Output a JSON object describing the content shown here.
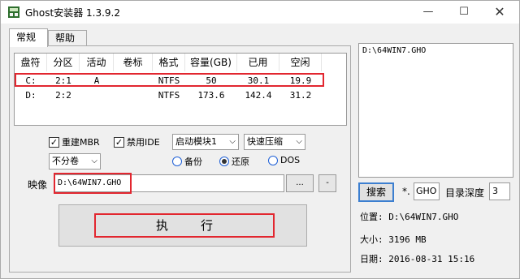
{
  "window": {
    "title": "Ghost安装器 1.3.9.2",
    "minimize": "—",
    "maximize": "☐",
    "close": "✕"
  },
  "tabs": [
    {
      "label": "常规"
    },
    {
      "label": "帮助"
    }
  ],
  "partition_table": {
    "headers": [
      "盘符",
      "分区",
      "活动",
      "卷标",
      "格式",
      "容量(GB)",
      "已用",
      "空闲"
    ],
    "rows": [
      [
        "C:",
        "2:1",
        "A",
        "",
        "NTFS",
        "50",
        "30.1",
        "19.9"
      ],
      [
        "D:",
        "2:2",
        "",
        "",
        "NTFS",
        "173.6",
        "142.4",
        "31.2"
      ]
    ]
  },
  "options": {
    "rebuild_mbr": {
      "label": "重建MBR",
      "checked": true
    },
    "disable_ide": {
      "label": "禁用IDE",
      "checked": true
    },
    "boot_module": "启动模块1",
    "compress": "快速压缩",
    "split": "不分卷",
    "mode": {
      "backup": "备份",
      "restore": "还原",
      "dos": "DOS",
      "selected": "restore"
    }
  },
  "image": {
    "label": "映像",
    "path": "D:\\64WIN7.GHO",
    "browse_label": "...",
    "minus_label": "-"
  },
  "execute_label": "执行",
  "right_panel": {
    "file_list": [
      "D:\\64WIN7.GHO"
    ],
    "search_label": "搜索",
    "ext_prefix": "*.",
    "ext_value": "GHO",
    "depth_label": "目录深度",
    "depth_value": "3",
    "location": "位置: D:\\64WIN7.GHO",
    "size": "大小: 3196 MB",
    "date": "日期: 2016-08-31   15:16"
  },
  "colors": {
    "highlight": "#e2262f",
    "accent": "#3c7fd0"
  }
}
